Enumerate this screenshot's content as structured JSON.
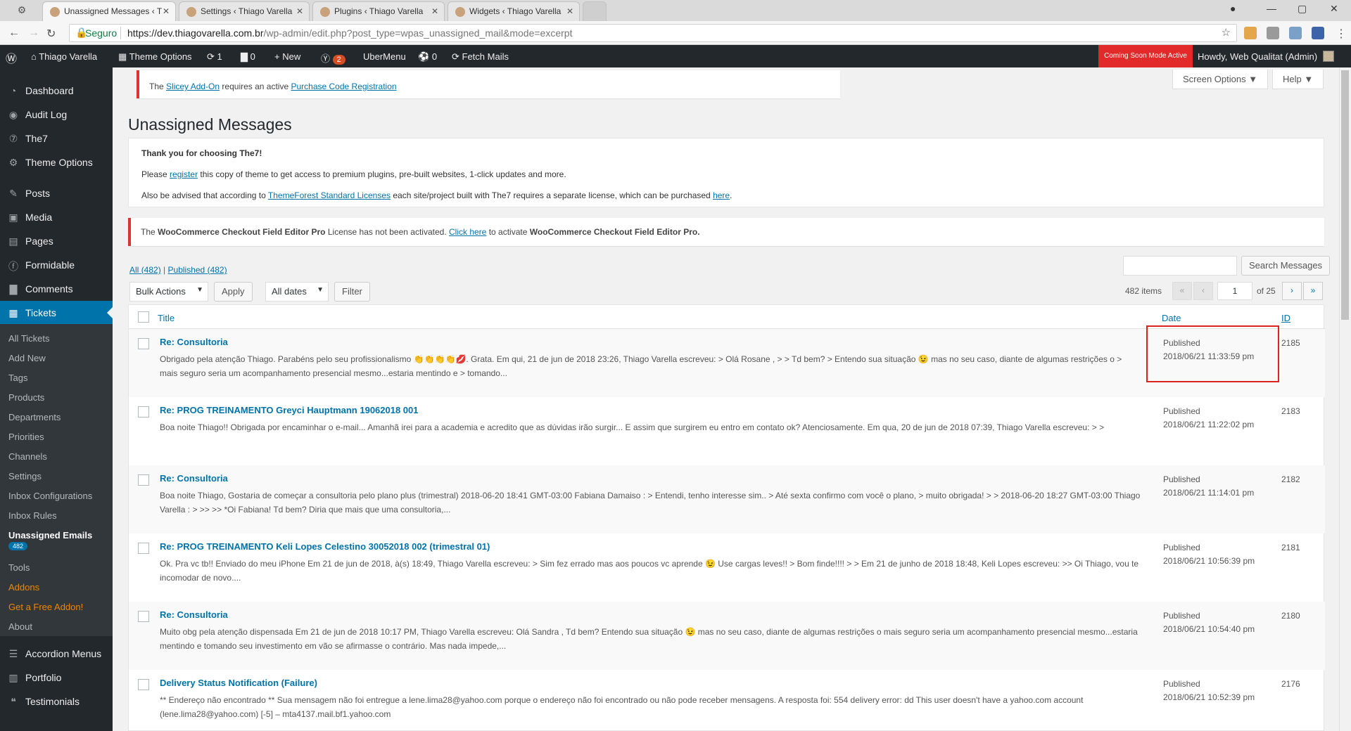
{
  "browser": {
    "tabs": [
      {
        "title": "Unassigned Messages ‹ T",
        "active": true
      },
      {
        "title": "Settings ‹ Thiago Varella",
        "active": false
      },
      {
        "title": "Plugins ‹ Thiago Varella",
        "active": false
      },
      {
        "title": "Widgets ‹ Thiago Varella",
        "active": false
      }
    ],
    "secure_label": "Seguro",
    "url_host": "https://dev.thiagovarella.com.br",
    "url_path": "/wp-admin/edit.php?post_type=wpas_unassigned_mail&mode=excerpt"
  },
  "adminbar": {
    "site_name": "Thiago Varella",
    "theme_options": "Theme Options",
    "updates_count": "1",
    "comments_count": "0",
    "new_label": "New",
    "yoast_count": "2",
    "ubermenu": "UberMenu",
    "circle_count": "0",
    "fetch_mails": "Fetch Mails",
    "coming_soon": "Coming Soon Mode Active",
    "howdy": "Howdy, Web Qualitat (Admin)"
  },
  "sidebar": {
    "top_items": [
      {
        "label": "Dashboard",
        "icon": "dashboard-icon"
      },
      {
        "label": "Audit Log",
        "icon": "audit-log-icon"
      },
      {
        "label": "The7",
        "icon": "the7-icon"
      },
      {
        "label": "Theme Options",
        "icon": "gear-icon"
      },
      {
        "label": "Posts",
        "icon": "pin-icon"
      },
      {
        "label": "Media",
        "icon": "media-icon"
      },
      {
        "label": "Pages",
        "icon": "pages-icon"
      },
      {
        "label": "Formidable",
        "icon": "formidable-icon"
      },
      {
        "label": "Comments",
        "icon": "comment-icon"
      },
      {
        "label": "Tickets",
        "icon": "tickets-icon"
      }
    ],
    "sub_items": [
      {
        "label": "All Tickets"
      },
      {
        "label": "Add New"
      },
      {
        "label": "Tags"
      },
      {
        "label": "Products"
      },
      {
        "label": "Departments"
      },
      {
        "label": "Priorities"
      },
      {
        "label": "Channels"
      },
      {
        "label": "Settings"
      },
      {
        "label": "Inbox Configurations"
      },
      {
        "label": "Inbox Rules"
      },
      {
        "label": "Unassigned Emails"
      },
      {
        "label": "Tools"
      },
      {
        "label": "Addons"
      },
      {
        "label": "Get a Free Addon!"
      },
      {
        "label": "About"
      }
    ],
    "unassigned_count": "482",
    "bottom_items": [
      {
        "label": "Accordion Menus",
        "icon": "menu-icon"
      },
      {
        "label": "Portfolio",
        "icon": "portfolio-icon"
      },
      {
        "label": "Testimonials",
        "icon": "testimonials-icon"
      }
    ]
  },
  "notices": {
    "slicey_prefix": "The",
    "slicey_link": "Slicey Add-On",
    "slicey_mid": "requires an active",
    "slicey_link2": "Purchase Code Registration",
    "woo_prefix": "The",
    "woo_name": "WooCommerce Checkout Field Editor Pro",
    "woo_mid": "License has not been activated.",
    "woo_link": "Click here",
    "woo_mid2": "to activate",
    "woo_name2": "WooCommerce Checkout Field Editor Pro."
  },
  "screen_options": "Screen Options ▼",
  "help": "Help ▼",
  "page_title": "Unassigned Messages",
  "the7": {
    "thanks": "Thank you for choosing The7!",
    "line2_a": "Please",
    "line2_link": "register",
    "line2_b": "this copy of theme to get access to premium plugins, pre-built websites, 1-click updates and more.",
    "line3_a": "Also be advised that according to",
    "line3_link": "ThemeForest Standard Licenses",
    "line3_b": "each site/project built with The7 requires a separate license, which can be purchased",
    "line3_link2": "here",
    "line3_c": "."
  },
  "filters": {
    "all": "All",
    "all_count": "(482)",
    "separator": "|",
    "published": "Published",
    "published_count": "(482)",
    "bulk_actions": "Bulk Actions",
    "apply": "Apply",
    "all_dates": "All dates",
    "filter": "Filter",
    "search_button": "Search Messages",
    "items": "482 items",
    "first": "«",
    "prev": "‹",
    "page": "1",
    "of": "of 25",
    "next": "›",
    "last": "»"
  },
  "table": {
    "headers": {
      "title": "Title",
      "date": "Date",
      "id": "ID"
    },
    "rows": [
      {
        "title": "Re: Consultoria",
        "excerpt": "Obrigado pela atenção Thiago. Parabéns pelo seu profissionalismo 👏👏👏👏💋. Grata. Em qui, 21 de jun de 2018 23:26, Thiago Varella escreveu: > Olá Rosane , > > Td bem? > Entendo sua situação 😉 mas no seu caso, diante de algumas restrições o > mais seguro seria um acompanhamento presencial mesmo...estaria mentindo e > tomando...",
        "status": "Published",
        "date": "2018/06/21 11:33:59 pm",
        "id": "2185"
      },
      {
        "title": "Re: PROG TREINAMENTO Greyci Hauptmann 19062018 001",
        "excerpt": "Boa noite Thiago!! Obrigada por encaminhar o e-mail... Amanhã irei para a academia e acredito que as dúvidas irão surgir... E assim que surgirem eu entro em contato ok? Atenciosamente. Em qua, 20 de jun de 2018 07:39, Thiago Varella escreveu: > >",
        "status": "Published",
        "date": "2018/06/21 11:22:02 pm",
        "id": "2183"
      },
      {
        "title": "Re: Consultoria",
        "excerpt": "Boa noite Thiago, Gostaria de começar a consultoria pelo plano plus (trimestral) 2018-06-20 18:41 GMT-03:00 Fabiana Damaiso : > Entendi, tenho interesse sim.. > Até sexta confirmo com você o plano, > muito obrigada! > > 2018-06-20 18:27 GMT-03:00 Thiago Varella : > >> >> *Oi Fabiana! Td bem? Diria que mais que uma consultoria,...",
        "status": "Published",
        "date": "2018/06/21 11:14:01 pm",
        "id": "2182"
      },
      {
        "title": "Re: PROG TREINAMENTO Keli Lopes Celestino 30052018 002 (trimestral 01)",
        "excerpt": "Ok. Pra vc tb!! Enviado do meu iPhone Em 21 de jun de 2018, à(s) 18:49, Thiago Varella escreveu: > Sim fez errado mas aos poucos vc aprende 😉 Use cargas leves!! > Bom finde!!!! > > Em 21 de junho de 2018 18:48, Keli Lopes escreveu: >> Oi Thiago, vou te incomodar de novo....",
        "status": "Published",
        "date": "2018/06/21 10:56:39 pm",
        "id": "2181"
      },
      {
        "title": "Re: Consultoria",
        "excerpt": "Muito obg pela atenção dispensada Em 21 de jun de 2018 10:17 PM, Thiago Varella escreveu: Olá Sandra , Td bem? Entendo sua situação 😉 mas no seu caso, diante de algumas restrições o mais seguro seria um acompanhamento presencial mesmo...estaria mentindo e tomando seu investimento em vão se afirmasse o contrário. Mas nada impede,...",
        "status": "Published",
        "date": "2018/06/21 10:54:40 pm",
        "id": "2180"
      },
      {
        "title": "Delivery Status Notification (Failure)",
        "excerpt": "** Endereço não encontrado ** Sua mensagem não foi entregue a lene.lima28@yahoo.com porque o endereço não foi encontrado ou não pode receber mensagens. A resposta foi: 554 delivery error: dd This user doesn't have a yahoo.com account (lene.lima28@yahoo.com) [-5] – mta4137.mail.bf1.yahoo.com",
        "status": "Published",
        "date": "2018/06/21 10:52:39 pm",
        "id": "2176"
      }
    ]
  },
  "colors": {
    "accent": "#0073aa",
    "admin_bar": "#23282d",
    "error": "#dc3232",
    "coming_soon": "#e22a2a"
  }
}
